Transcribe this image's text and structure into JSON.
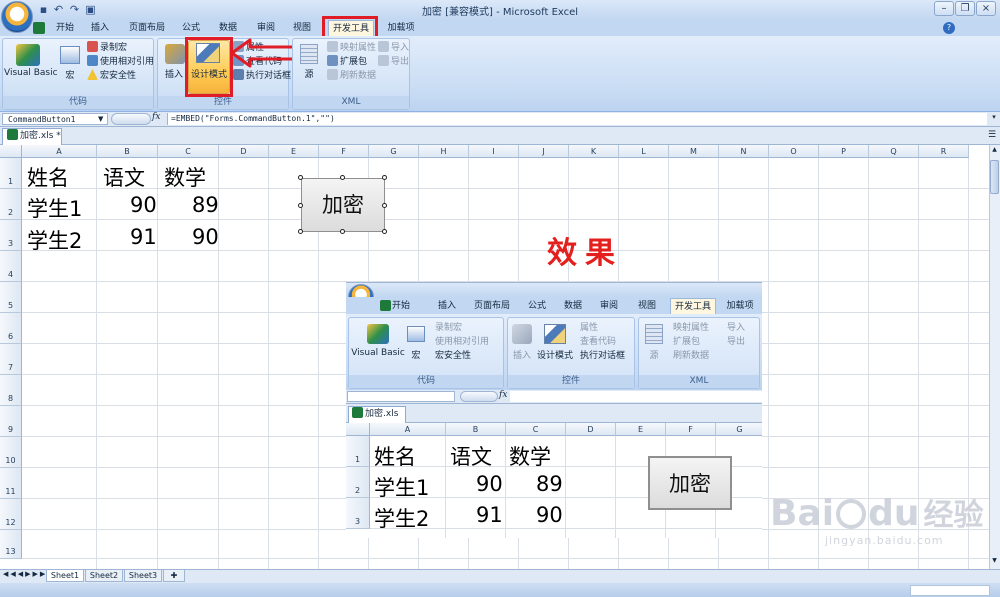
{
  "window": {
    "title": "加密  [兼容模式] - Microsoft Excel",
    "tabs": [
      "开始",
      "插入",
      "页面布局",
      "公式",
      "数据",
      "审阅",
      "视图",
      "开发工具",
      "加载项"
    ],
    "active_tab": "开发工具"
  },
  "ribbon": {
    "groups": {
      "code": {
        "label": "代码",
        "visual_basic": "Visual Basic",
        "macro": "宏",
        "record_macro": "录制宏",
        "relative_ref": "使用相对引用",
        "macro_security": "宏安全性"
      },
      "controls": {
        "label": "控件",
        "insert": "插入",
        "design_mode": "设计模式",
        "properties": "属性",
        "view_code": "查看代码",
        "run_dialog": "执行对话框"
      },
      "xml": {
        "label": "XML",
        "source": "源",
        "map_props": "映射属性",
        "expansion": "扩展包",
        "refresh": "刷新数据",
        "import": "导入",
        "export": "导出"
      }
    }
  },
  "formula_bar": {
    "name_box": "CommandButton1",
    "fx": "fx",
    "formula": "=EMBED(\"Forms.CommandButton.1\",\"\")"
  },
  "workbook_tab": "加密.xls *",
  "sheet": {
    "columns": [
      "A",
      "B",
      "C",
      "D",
      "E",
      "F",
      "G",
      "H",
      "I",
      "J",
      "K",
      "L",
      "M",
      "N",
      "O",
      "P",
      "Q",
      "R"
    ],
    "rows": [
      "1",
      "2",
      "3",
      "4",
      "5",
      "6",
      "7",
      "8",
      "9",
      "10",
      "11",
      "12",
      "13"
    ],
    "cells": [
      [
        "姓名",
        "语文",
        "数学"
      ],
      [
        "学生1",
        "90",
        "89"
      ],
      [
        "学生2",
        "91",
        "90"
      ]
    ],
    "button_label": "加密"
  },
  "annotation": "效果",
  "inset": {
    "tabs": [
      "开始",
      "插入",
      "页面布局",
      "公式",
      "数据",
      "审阅",
      "视图",
      "开发工具",
      "加载项"
    ],
    "columns": [
      "A",
      "B",
      "C",
      "D",
      "E",
      "F",
      "G"
    ],
    "rows": [
      "1",
      "2",
      "3"
    ]
  },
  "sheet_tabs": [
    "Sheet1",
    "Sheet2",
    "Sheet3"
  ],
  "watermark": {
    "brand": "Bai",
    "brand2": "du",
    "brand_cn": "经验",
    "url": "jingyan.baidu.com"
  },
  "colors": {
    "highlight_red": "#e01d26",
    "effect_red": "#e3201d",
    "ribbon_blue": "#c2d7f1"
  }
}
